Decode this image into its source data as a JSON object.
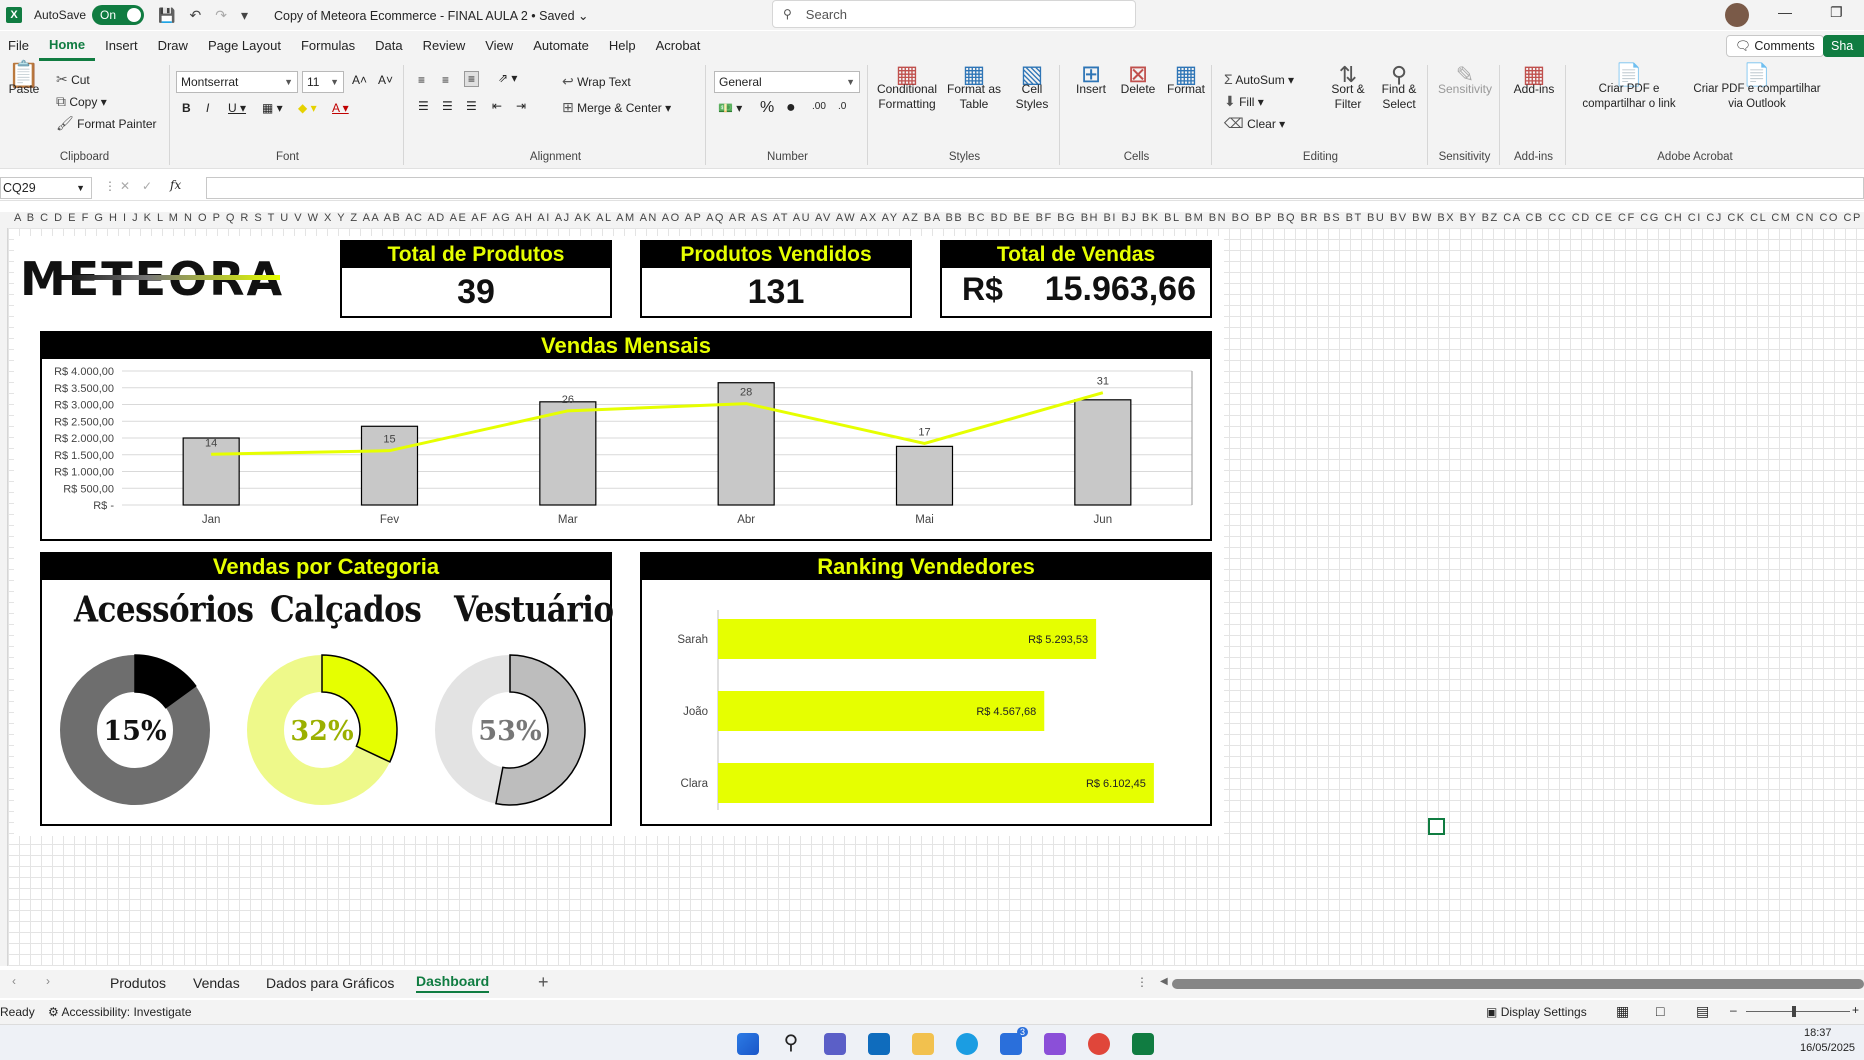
{
  "titlebar": {
    "autosave_label": "AutoSave",
    "autosave_state": "On",
    "doc_title": "Copy of Meteora Ecommerce - FINAL AULA 2 • Saved ⌄",
    "search_placeholder": "Search"
  },
  "menu": {
    "items": [
      "File",
      "Home",
      "Insert",
      "Draw",
      "Page Layout",
      "Formulas",
      "Data",
      "Review",
      "View",
      "Automate",
      "Help",
      "Acrobat"
    ],
    "active": "Home",
    "comments_label": "Comments",
    "share_label": "Sha"
  },
  "ribbon": {
    "clipboard": {
      "label": "Clipboard",
      "paste": "Paste",
      "cut": "Cut",
      "copy": "Copy",
      "format_painter": "Format Painter"
    },
    "font": {
      "label": "Font",
      "font_name": "Montserrat",
      "font_size": "11"
    },
    "alignment": {
      "label": "Alignment",
      "wrap_text": "Wrap Text",
      "merge_center": "Merge & Center"
    },
    "number": {
      "label": "Number",
      "format": "General"
    },
    "styles": {
      "label": "Styles",
      "conditional": "Conditional Formatting",
      "format_table": "Format as Table",
      "cell_styles": "Cell Styles"
    },
    "cells": {
      "label": "Cells",
      "insert": "Insert",
      "delete": "Delete",
      "format": "Format"
    },
    "editing": {
      "label": "Editing",
      "autosum": "AutoSum",
      "fill": "Fill",
      "clear": "Clear",
      "sort_filter": "Sort & Filter",
      "find_select": "Find & Select"
    },
    "sensitivity": {
      "label": "Sensitivity",
      "button": "Sensitivity"
    },
    "addins": {
      "label": "Add-ins",
      "button": "Add-ins"
    },
    "acrobat": {
      "label": "Adobe Acrobat",
      "pdf_link": "Criar PDF e compartilhar o link",
      "pdf_outlook": "Criar PDF e compartilhar via Outlook"
    }
  },
  "formula_bar": {
    "name_box": "CQ29",
    "fx": "fx",
    "content": ""
  },
  "column_header_text": "A B C D E F G H I J K L M N O P Q R S T U V W X Y Z AA AB AC AD AE AF AG AH AI AJ AK AL AM AN AO AP AQ AR AS AT AU AV AW AX AY AZ BA BB BC BD BE BF BG BH BI BJ BK BL BM BN BO BP BQ BR BS BT BU BV BW BX BY BZ CA CB CC CD CE CF CG CH CI CJ CK CL CM CN CO CP CQ CR CS CT CU CV CW CX CY CZ DA DB DC DD DE DF DG DH DI DJ DK DL DM DN DO DP DQ DR DS",
  "dashboard": {
    "logo": "METEORA",
    "kpis": [
      {
        "title": "Total de Produtos",
        "value": "39"
      },
      {
        "title": "Produtos Vendidos",
        "value": "131"
      },
      {
        "title": "Total de Vendas",
        "currency": "R$",
        "value": "15.963,66"
      }
    ],
    "monthly_title": "Vendas Mensais",
    "category_title": "Vendas por Categoria",
    "ranking_title": "Ranking Vendedores",
    "categories": [
      {
        "name": "Acessórios",
        "percent_label": "15%",
        "value": 0.15,
        "fill": "#000000",
        "track": "#6e6e6e",
        "text_color": "#111111"
      },
      {
        "name": "Calçados",
        "percent_label": "32%",
        "value": 0.32,
        "fill": "#e6ff00",
        "track": "#eef98a",
        "text_color": "#9bb000"
      },
      {
        "name": "Vestuário",
        "percent_label": "53%",
        "value": 0.53,
        "fill": "#bdbdbd",
        "track": "#e3e3e3",
        "text_color": "#777777"
      }
    ]
  },
  "chart_data": [
    {
      "type": "bar",
      "title": "Vendas Mensais",
      "categories": [
        "Jan",
        "Fev",
        "Mar",
        "Abr",
        "Mai",
        "Jun"
      ],
      "series": [
        {
          "values": [
            2000,
            2350,
            3080,
            3650,
            1750,
            3140
          ],
          "color": "#c8c8c8"
        },
        {
          "type": "line",
          "values": [
            14,
            15,
            26,
            28,
            17,
            31
          ],
          "labels": [
            "14",
            "15",
            "26",
            "28",
            "17",
            "31"
          ],
          "color": "#e6ff00"
        }
      ],
      "yticks": [
        "R$ 4.000,00",
        "R$ 3.500,00",
        "R$ 3.000,00",
        "R$ 2.500,00",
        "R$ 2.000,00",
        "R$ 1.500,00",
        "R$ 1.000,00",
        "R$ 500,00",
        "R$ -"
      ],
      "ylim": [
        0,
        4000
      ],
      "grid": true
    },
    {
      "type": "bar",
      "orientation": "horizontal",
      "title": "Ranking Vendedores",
      "categories": [
        "Sarah",
        "João",
        "Clara"
      ],
      "values": [
        5293.53,
        4567.68,
        6102.45
      ],
      "labels": [
        "R$ 5.293,53",
        "R$ 4.567,68",
        "R$ 6.102,45"
      ],
      "xlim": [
        0,
        7000
      ],
      "color": "#e6ff00"
    }
  ],
  "sheet_tabs": [
    "Produtos",
    "Vendas",
    "Dados para Gráficos",
    "Dashboard"
  ],
  "active_sheet": "Dashboard",
  "status": {
    "ready": "Ready",
    "accessibility": "Accessibility: Investigate",
    "display_settings": "Display Settings"
  },
  "taskbar": {
    "time": "18:37",
    "date": "16/05/2025",
    "badge": "3"
  }
}
